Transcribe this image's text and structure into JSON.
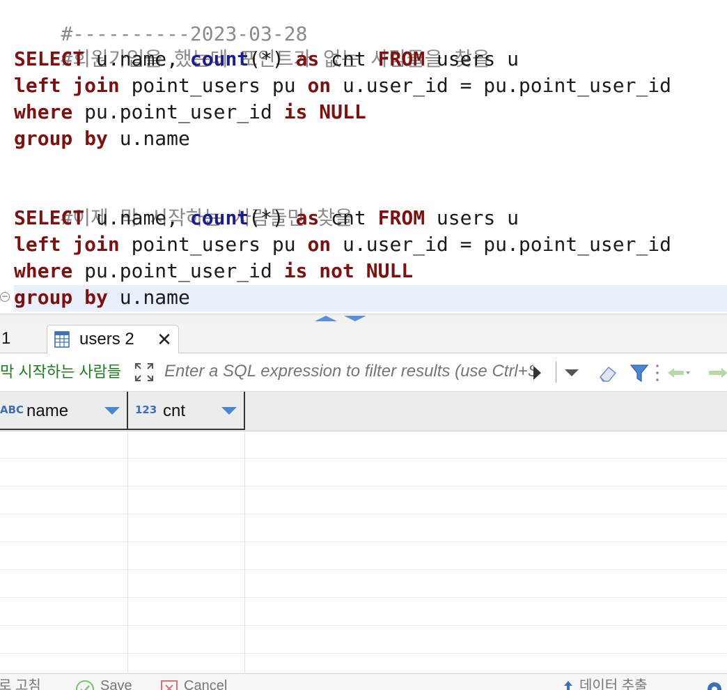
{
  "editor": {
    "lines": [
      {
        "type": "comment",
        "text": "#----------2023-03-28"
      },
      {
        "type": "comment",
        "text": "#회원가입을 했는데 포인트가 없는 사람들을 찾을"
      },
      {
        "type": "code",
        "parts": [
          "SELECT",
          " u.name, ",
          "count",
          "(*) ",
          "as",
          " cnt ",
          "FROM",
          " users u"
        ]
      },
      {
        "type": "code",
        "parts": [
          "left join",
          " point_users pu ",
          "on",
          " u.user_id = pu.point_user_id"
        ]
      },
      {
        "type": "code",
        "parts": [
          "where",
          " pu.point_user_id ",
          "is NULL"
        ]
      },
      {
        "type": "code",
        "parts": [
          "group by",
          " u.name"
        ]
      },
      {
        "type": "comment",
        "text": "#이제 막 시작하는 사람들만 찾을"
      },
      {
        "type": "code",
        "parts": [
          "SELECT",
          " u.name, ",
          "count",
          "(*) ",
          "as",
          " cnt ",
          "FROM",
          " users u"
        ]
      },
      {
        "type": "code",
        "parts": [
          "left join",
          " point_users pu ",
          "on",
          " u.user_id = pu.point_user_id"
        ]
      },
      {
        "type": "code",
        "parts": [
          "where",
          " pu.point_user_id ",
          "is not NULL"
        ]
      },
      {
        "type": "code",
        "parts": [
          "group by",
          " u.name"
        ]
      }
    ]
  },
  "results": {
    "tabs": [
      {
        "label": "1"
      },
      {
        "label": "users 2",
        "close_glyph": "✕"
      }
    ],
    "query_label": "막 시작하는 사람들",
    "filter_placeholder": "Enter a SQL expression to filter results (use Ctrl+Space)",
    "columns": [
      {
        "type_badge": "ABC",
        "name": "name"
      },
      {
        "type_badge": "123",
        "name": "cnt"
      }
    ]
  },
  "bottom_toolbar": {
    "refresh_label": "로 고침",
    "save_label": "Save",
    "cancel_label": "Cancel",
    "export_label": "데이터 추출"
  },
  "colors": {
    "keyword": "#7f1010",
    "function": "#1c1e8f",
    "comment": "#8a8a8a",
    "current_line": "#e9f0fb",
    "accent": "#4a86cf"
  },
  "icons": [
    "table-icon",
    "close-icon",
    "expand-icon",
    "history-arrow-icon",
    "dropdown-icon",
    "eraser-icon",
    "funnel-icon",
    "back-arrow-icon",
    "forward-arrow-icon",
    "sort-arrow-icon",
    "check-icon",
    "cancel-icon",
    "export-icon",
    "gear-icon"
  ]
}
